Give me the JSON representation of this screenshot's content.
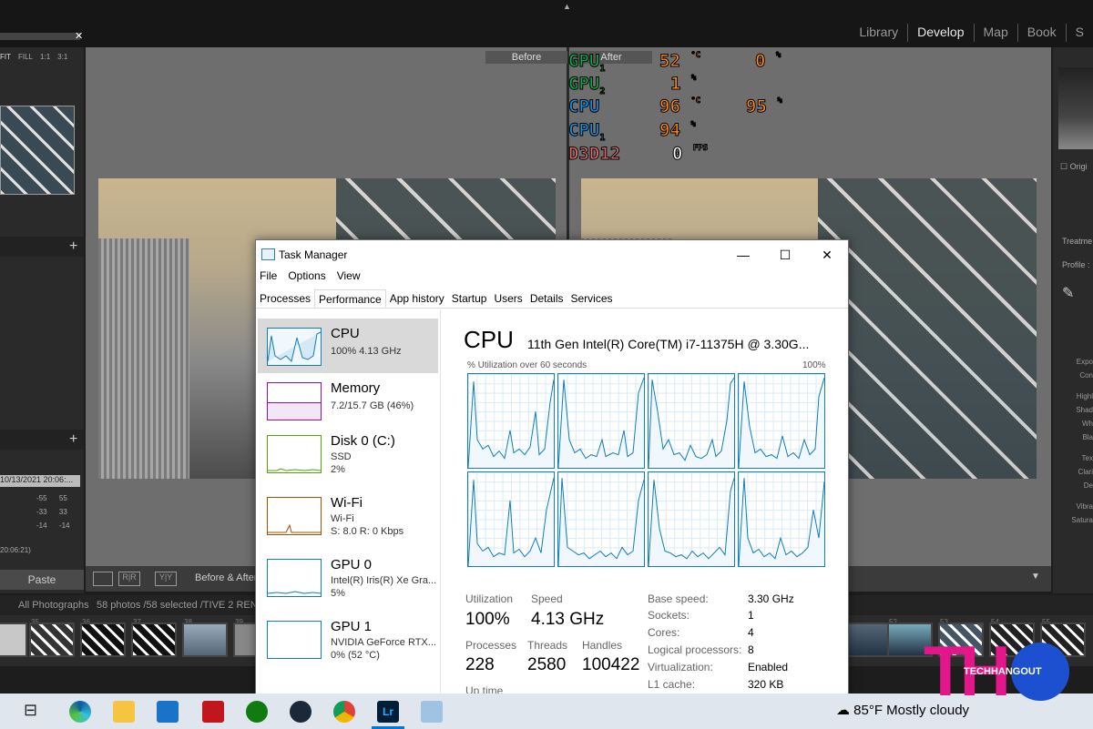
{
  "lightroom": {
    "modules": [
      "Library",
      "Develop",
      "Map",
      "Book",
      "S"
    ],
    "active_module": "Develop",
    "zoom_options": [
      "FIT",
      "FILL",
      "1:1",
      "3:1"
    ],
    "left_panel": {
      "date": "10/13/2021 20:06:...",
      "values": [
        [
          "-55",
          "55"
        ],
        [
          "-33",
          "33"
        ],
        [
          "-14",
          "-14"
        ]
      ],
      "time": "20:06:21)"
    },
    "paste_label": "Paste",
    "before_label": "Before",
    "after_label": "After",
    "toolbar_mode": "Before & After",
    "filmstrip": {
      "source": "All Photographs",
      "count": "58 photos /58 selected /TIVE 2 RENDER",
      "numbers": [
        "35",
        "36",
        "37",
        "38",
        "39",
        "52",
        "53",
        "54",
        "55"
      ]
    },
    "right_panel": {
      "origin_label": "Origi",
      "treatment": "Treatme",
      "profile": "Profile :",
      "adjustments": [
        "Expo",
        "Con",
        "Highl",
        "Shad",
        "Wh",
        "Bla",
        "Tex",
        "Clari",
        "De",
        "Vibra",
        "Satura"
      ]
    }
  },
  "osd": {
    "rows": [
      {
        "label": "GPU",
        "sub": "1",
        "color": "#0fa84a",
        "v1": "52",
        "u1": "°C",
        "v2": "0",
        "u2": "%"
      },
      {
        "label": "GPU",
        "sub": "2",
        "color": "#0fa84a",
        "v1": "1",
        "u1": "%",
        "v2": "",
        "u2": ""
      },
      {
        "label": "CPU",
        "sub": "",
        "color": "#1a8fe0",
        "v1": "96",
        "u1": "°C",
        "v2": "95",
        "u2": "%"
      },
      {
        "label": "CPU",
        "sub": "1",
        "color": "#1a8fe0",
        "v1": "94",
        "u1": "%",
        "v2": "",
        "u2": ""
      },
      {
        "label": "D3D12",
        "sub": "",
        "color": "#e06a6a",
        "v1": "0",
        "u1": "FPS",
        "v2": "",
        "u2": ""
      }
    ]
  },
  "task_manager": {
    "title": "Task Manager",
    "menu": [
      "File",
      "Options",
      "View"
    ],
    "tabs": [
      "Processes",
      "Performance",
      "App history",
      "Startup",
      "Users",
      "Details",
      "Services"
    ],
    "active_tab": "Performance",
    "sidebar": [
      {
        "name": "CPU",
        "lines": [
          "100%  4.13 GHz"
        ],
        "color": "#117dbb"
      },
      {
        "name": "Memory",
        "lines": [
          "7.2/15.7 GB (46%)"
        ],
        "color": "#8b12ae"
      },
      {
        "name": "Disk 0 (C:)",
        "lines": [
          "SSD",
          "2%"
        ],
        "color": "#4da60c"
      },
      {
        "name": "Wi-Fi",
        "lines": [
          "Wi-Fi",
          "S: 8.0  R: 0 Kbps"
        ],
        "color": "#a74f01"
      },
      {
        "name": "GPU 0",
        "lines": [
          "Intel(R) Iris(R) Xe Gra...",
          "5%"
        ],
        "color": "#117dbb"
      },
      {
        "name": "GPU 1",
        "lines": [
          "NVIDIA GeForce RTX...",
          "0% (52 °C)"
        ],
        "color": "#117dbb"
      }
    ],
    "cpu_title": "CPU",
    "cpu_model": "11th Gen Intel(R) Core(TM) i7-11375H @ 3.30G...",
    "graph_label": "% Utilization over 60 seconds",
    "graph_max": "100%",
    "stats": {
      "utilization_label": "Utilization",
      "utilization": "100%",
      "speed_label": "Speed",
      "speed": "4.13 GHz",
      "processes_label": "Processes",
      "processes": "228",
      "threads_label": "Threads",
      "threads": "2580",
      "handles_label": "Handles",
      "handles": "100422",
      "uptime_label": "Up time"
    },
    "details": [
      [
        "Base speed:",
        "3.30 GHz"
      ],
      [
        "Sockets:",
        "1"
      ],
      [
        "Cores:",
        "4"
      ],
      [
        "Logical processors:",
        "8"
      ],
      [
        "Virtualization:",
        "Enabled"
      ],
      [
        "L1 cache:",
        "320 KB"
      ]
    ]
  },
  "taskbar": {
    "weather": "85°F  Mostly cloudy",
    "icons": [
      "task-view-icon",
      "edge-icon",
      "file-explorer-icon",
      "mail-icon",
      "app-red-icon",
      "xbox-icon",
      "steam-icon",
      "chrome-icon",
      "lightroom-icon",
      "photos-icon"
    ],
    "lightroom_label": "Lr"
  },
  "logo": {
    "text": "TECHHANGOUT",
    "mark": "TH"
  }
}
